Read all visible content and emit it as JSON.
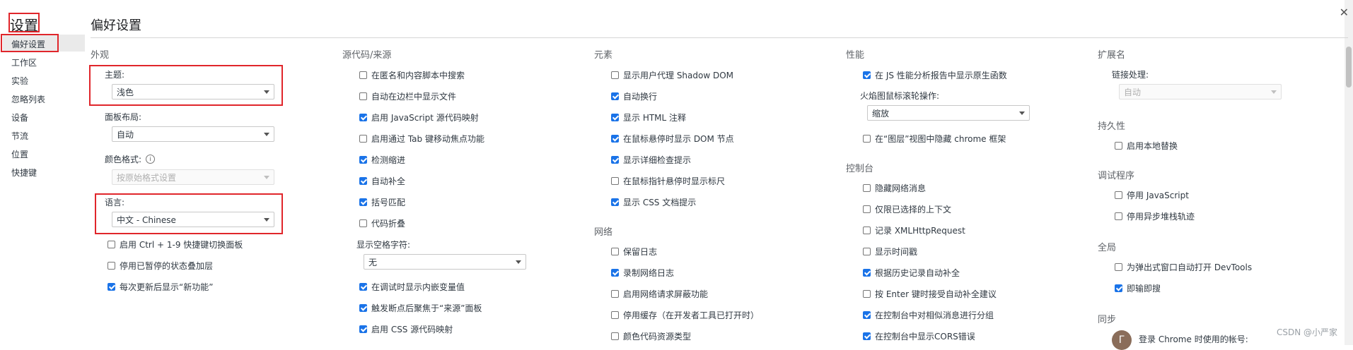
{
  "sidebar": {
    "title": "设置",
    "items": [
      "偏好设置",
      "工作区",
      "实验",
      "忽略列表",
      "设备",
      "节流",
      "位置",
      "快捷键"
    ]
  },
  "page_title": "偏好设置",
  "appearance": {
    "title": "外观",
    "theme_label": "主题:",
    "theme_value": "浅色",
    "panel_label": "面板布局:",
    "panel_value": "自动",
    "color_label": "颜色格式:",
    "color_value": "按原始格式设置",
    "lang_label": "语言:",
    "lang_value": "中文 - Chinese",
    "checks": [
      {
        "label": "启用 Ctrl + 1-9 快捷键切换面板",
        "checked": false
      },
      {
        "label": "停用已暂停的状态叠加层",
        "checked": false
      },
      {
        "label": "每次更新后显示“新功能”",
        "checked": true
      }
    ]
  },
  "sources": {
    "title": "源代码/来源",
    "checks": [
      {
        "label": "在匿名和内容脚本中搜索",
        "checked": false
      },
      {
        "label": "自动在边栏中显示文件",
        "checked": false
      },
      {
        "label": "启用 JavaScript 源代码映射",
        "checked": true
      },
      {
        "label": "启用通过 Tab 键移动焦点功能",
        "checked": false
      },
      {
        "label": "检测缩进",
        "checked": true
      },
      {
        "label": "自动补全",
        "checked": true
      },
      {
        "label": "括号匹配",
        "checked": true
      },
      {
        "label": "代码折叠",
        "checked": false
      }
    ],
    "whitespace_label": "显示空格字符:",
    "whitespace_value": "无",
    "checks2": [
      {
        "label": "在调试时显示内嵌变量值",
        "checked": true
      },
      {
        "label": "触发断点后聚焦于“来源”面板",
        "checked": true
      },
      {
        "label": "启用 CSS 源代码映射",
        "checked": true
      }
    ]
  },
  "elements": {
    "title": "元素",
    "checks": [
      {
        "label": "显示用户代理 Shadow DOM",
        "checked": false
      },
      {
        "label": "自动换行",
        "checked": true
      },
      {
        "label": "显示 HTML 注释",
        "checked": true
      },
      {
        "label": "在鼠标悬停时显示 DOM 节点",
        "checked": true
      },
      {
        "label": "显示详细检查提示",
        "checked": true
      },
      {
        "label": "在鼠标指针悬停时显示标尺",
        "checked": false
      },
      {
        "label": "显示 CSS 文档提示",
        "checked": true
      }
    ]
  },
  "network": {
    "title": "网络",
    "checks": [
      {
        "label": "保留日志",
        "checked": false
      },
      {
        "label": "录制网络日志",
        "checked": true
      },
      {
        "label": "启用网络请求屏蔽功能",
        "checked": false
      },
      {
        "label": "停用缓存（在开发者工具已打开时）",
        "checked": false
      },
      {
        "label": "颜色代码资源类型",
        "checked": false
      }
    ]
  },
  "performance": {
    "title": "性能",
    "check1": {
      "label": "在 JS 性能分析报告中显示原生函数",
      "checked": true
    },
    "flame_label": "火焰图鼠标滚轮操作:",
    "flame_value": "缩放",
    "check2": {
      "label": "在“图层”视图中隐藏 chrome 框架",
      "checked": false
    }
  },
  "console": {
    "title": "控制台",
    "checks": [
      {
        "label": "隐藏网络消息",
        "checked": false
      },
      {
        "label": "仅限已选择的上下文",
        "checked": false
      },
      {
        "label": "记录 XMLHttpRequest",
        "checked": false
      },
      {
        "label": "显示时间戳",
        "checked": false
      },
      {
        "label": "根据历史记录自动补全",
        "checked": true
      },
      {
        "label": "按 Enter 键时接受自动补全建议",
        "checked": false
      },
      {
        "label": "在控制台中对相似消息进行分组",
        "checked": true
      },
      {
        "label": "在控制台中显示CORS错误",
        "checked": true
      }
    ]
  },
  "extensions": {
    "title": "扩展名",
    "link_label": "链接处理:",
    "link_value": "自动"
  },
  "persistence": {
    "title": "持久性",
    "check": {
      "label": "启用本地替换",
      "checked": false
    }
  },
  "debugger": {
    "title": "调试程序",
    "checks": [
      {
        "label": "停用 JavaScript",
        "checked": false
      },
      {
        "label": "停用异步堆栈轨迹",
        "checked": false
      }
    ]
  },
  "global": {
    "title": "全局",
    "checks": [
      {
        "label": "为弹出式窗口自动打开 DevTools",
        "checked": false
      },
      {
        "label": "即输即搜",
        "checked": true
      }
    ]
  },
  "sync": {
    "title": "同步",
    "account_text": "登录 Chrome 时使用的帐号:",
    "avatar_letter": "Г"
  },
  "watermark": "CSDN @小严家"
}
